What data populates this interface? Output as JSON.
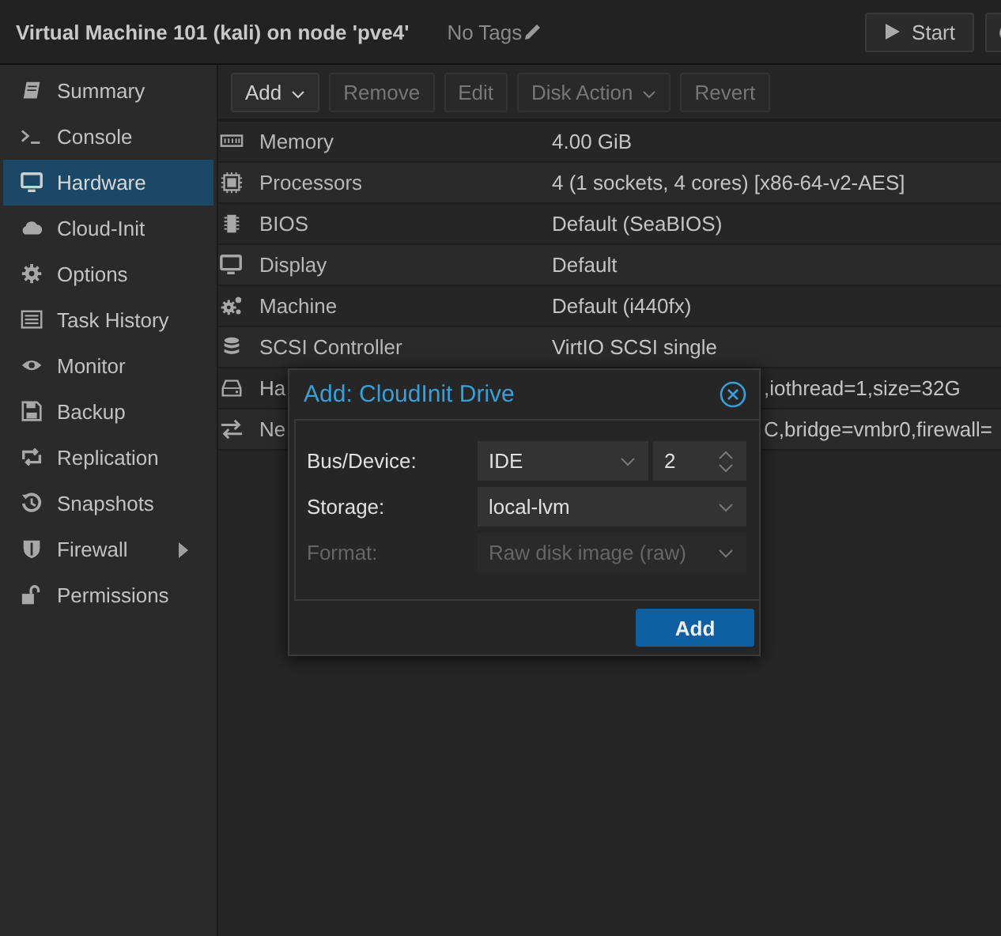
{
  "header": {
    "title": "Virtual Machine 101 (kali) on node 'pve4'",
    "tags": "No Tags",
    "start_button": "Start"
  },
  "sidebar": {
    "items": [
      {
        "label": "Summary",
        "selected": false
      },
      {
        "label": "Console",
        "selected": false
      },
      {
        "label": "Hardware",
        "selected": true
      },
      {
        "label": "Cloud-Init",
        "selected": false
      },
      {
        "label": "Options",
        "selected": false
      },
      {
        "label": "Task History",
        "selected": false
      },
      {
        "label": "Monitor",
        "selected": false
      },
      {
        "label": "Backup",
        "selected": false
      },
      {
        "label": "Replication",
        "selected": false
      },
      {
        "label": "Snapshots",
        "selected": false
      },
      {
        "label": "Firewall",
        "selected": false,
        "expandable": true
      },
      {
        "label": "Permissions",
        "selected": false
      }
    ]
  },
  "toolbar": [
    {
      "label": "Add",
      "disabled": false,
      "menu": true
    },
    {
      "label": "Remove",
      "disabled": true,
      "menu": false
    },
    {
      "label": "Edit",
      "disabled": true,
      "menu": false
    },
    {
      "label": "Disk Action",
      "disabled": true,
      "menu": true
    },
    {
      "label": "Revert",
      "disabled": true,
      "menu": false
    }
  ],
  "hardware": [
    {
      "name": "Memory",
      "value": "4.00 GiB",
      "kind": "full"
    },
    {
      "name": "Processors",
      "value": "4 (1 sockets, 4 cores) [x86-64-v2-AES]",
      "kind": "full"
    },
    {
      "name": "BIOS",
      "value": "Default (SeaBIOS)",
      "kind": "full"
    },
    {
      "name": "Display",
      "value": "Default",
      "kind": "full"
    },
    {
      "name": "Machine",
      "value": "Default (i440fx)",
      "kind": "full"
    },
    {
      "name": "SCSI Controller",
      "value": "VirtIO SCSI single",
      "kind": "full"
    },
    {
      "name": "Ha",
      "value": ",iothread=1,size=32G",
      "kind": "partial"
    },
    {
      "name": "Ne",
      "value": "C,bridge=vmbr0,firewall=",
      "kind": "partial"
    }
  ],
  "dialog": {
    "title": "Add: CloudInit Drive",
    "fields": [
      {
        "label": "Bus/Device:",
        "value": "IDE",
        "number": "2",
        "kind": "bus",
        "disabled": false
      },
      {
        "label": "Storage:",
        "value": "local-lvm",
        "kind": "select",
        "disabled": false
      },
      {
        "label": "Format:",
        "value": "Raw disk image (raw)",
        "kind": "select",
        "disabled": true
      }
    ],
    "button": "Add"
  }
}
